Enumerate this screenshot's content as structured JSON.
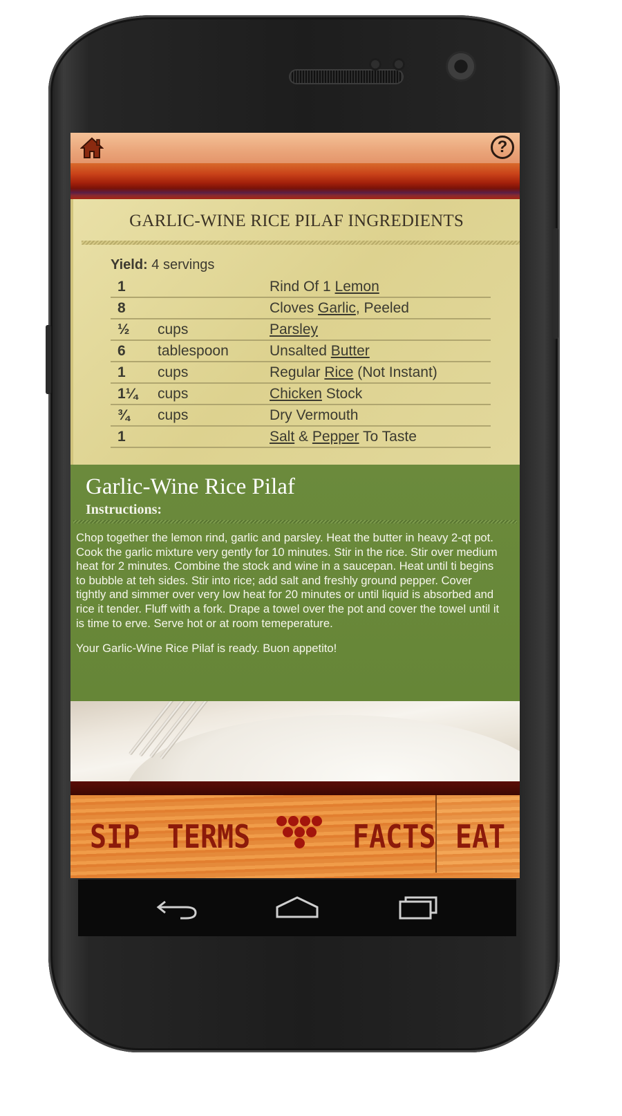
{
  "header": {
    "home_icon": "home-icon",
    "help_icon": "help-icon",
    "help_glyph": "?"
  },
  "ingredients": {
    "title": "GARLIC-WINE RICE PILAF INGREDIENTS",
    "yield_label": "Yield:",
    "yield_value": "4 servings",
    "rows": [
      {
        "qty": "1",
        "unit": "",
        "pre": "Rind Of 1 ",
        "link": "Lemon",
        "mid": "",
        "link2": "",
        "post": ""
      },
      {
        "qty": "8",
        "unit": "",
        "pre": "Cloves ",
        "link": "Garlic",
        "mid": "",
        "link2": "",
        "post": ", Peeled"
      },
      {
        "qty": "½",
        "unit": "cups",
        "pre": "",
        "link": "Parsley",
        "mid": "",
        "link2": "",
        "post": ""
      },
      {
        "qty": "6",
        "unit": "tablespoon",
        "pre": "Unsalted ",
        "link": "Butter",
        "mid": "",
        "link2": "",
        "post": ""
      },
      {
        "qty": "1",
        "unit": "cups",
        "pre": "Regular ",
        "link": "Rice",
        "mid": "",
        "link2": "",
        "post": " (Not Instant)"
      },
      {
        "qty": "1¼",
        "unit": "cups",
        "pre": "",
        "link": "Chicken",
        "mid": "",
        "link2": "",
        "post": " Stock"
      },
      {
        "qty": "¾",
        "unit": "cups",
        "pre": "Dry Vermouth",
        "link": "",
        "mid": "",
        "link2": "",
        "post": ""
      },
      {
        "qty": "1",
        "unit": "",
        "pre": "",
        "link": "Salt",
        "mid": " & ",
        "link2": "Pepper",
        "post": " To Taste"
      }
    ]
  },
  "recipe": {
    "title": "Garlic-Wine Rice Pilaf",
    "subtitle": "Instructions:",
    "paragraph1": "Chop together the lemon rind, garlic and parsley. Heat the butter in heavy 2-qt pot. Cook the garlic mixture very gently for 10 minutes. Stir in the rice. Stir over medium heat for 2 minutes. Combine the stock and wine in a saucepan. Heat until ti begins to bubble at teh sides. Stir into rice; add salt and freshly ground pepper. Cover tightly and simmer over very low heat for 20 minutes or until liquid is absorbed and rice it tender. Fluff with a fork. Drape a towel over the pot and cover the towel until it is time to erve. Serve hot or at room temeperature.",
    "paragraph2": "Your Garlic-Wine Rice Pilaf is ready. Buon appetito!"
  },
  "tabs": {
    "sip": "SIP",
    "terms": "TERMS",
    "grapes_icon": "grapes-icon",
    "facts": "FACTS",
    "eat": "EAT"
  },
  "navbar": {
    "back_icon": "back-icon",
    "home_icon": "home-outline-icon",
    "recents_icon": "recent-apps-icon"
  }
}
